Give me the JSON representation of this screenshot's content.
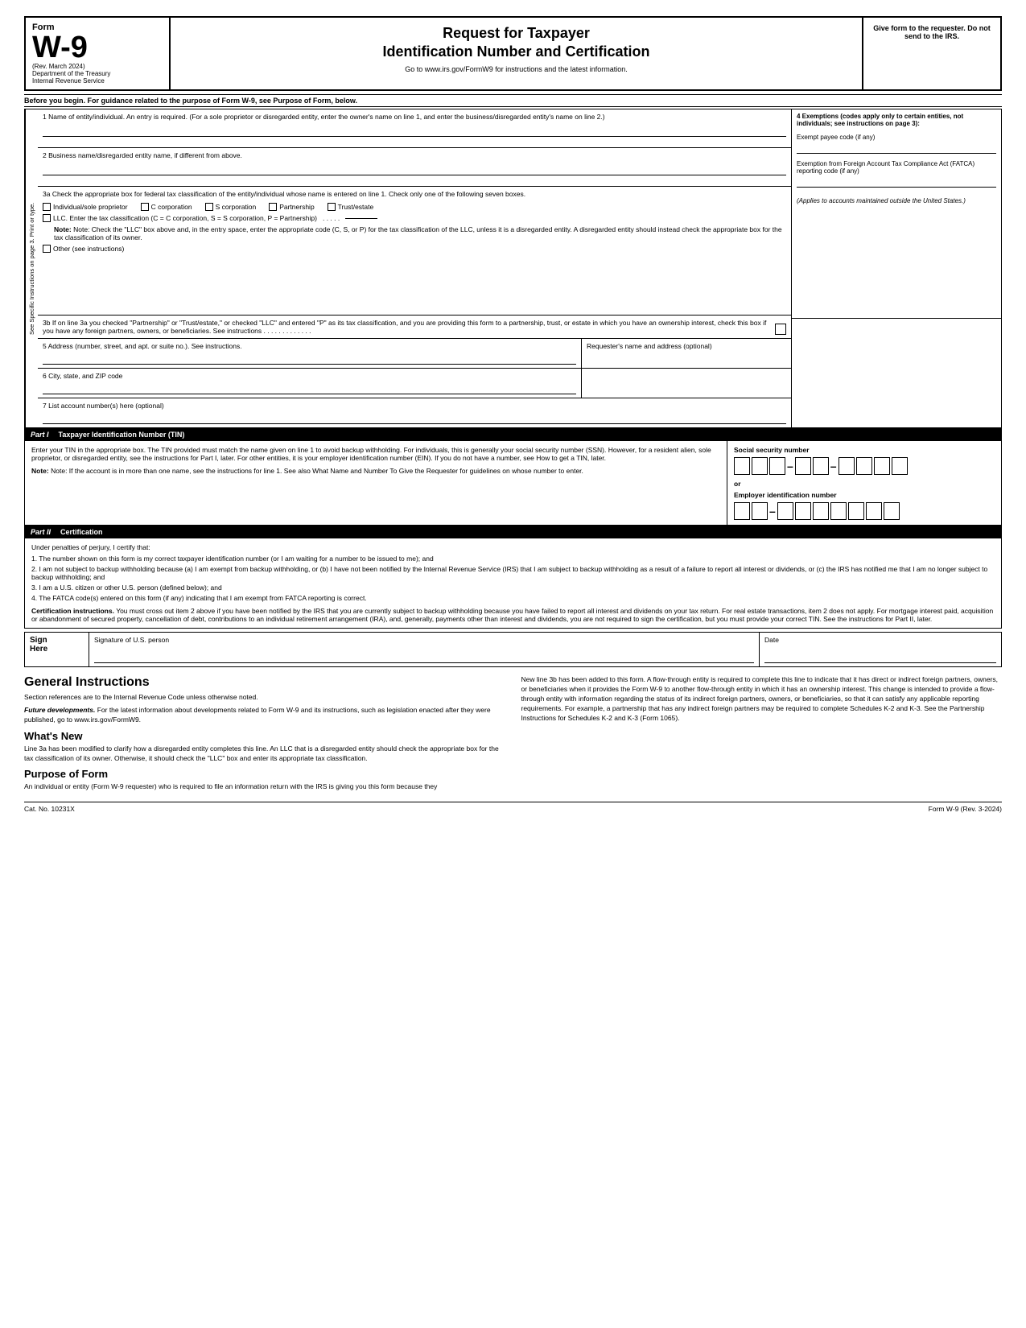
{
  "header": {
    "form_label": "Form",
    "form_number": "W-9",
    "rev_date": "(Rev. March 2024)",
    "dept": "Department of the Treasury",
    "irs": "Internal Revenue Service",
    "title_line1": "Request for Taxpayer",
    "title_line2": "Identification Number and Certification",
    "url_instruction": "Go to www.irs.gov/FormW9 for instructions and the latest information.",
    "give_form": "Give form to the requester. Do not send to the IRS."
  },
  "before_begin": {
    "text": "Before you begin. For guidance related to the purpose of Form W-9, see Purpose of Form, below."
  },
  "fields": {
    "field1_label": "1  Name of entity/individual. An entry is required. (For a sole proprietor or disregarded entity, enter the owner's name on line 1, and enter the business/disregarded entity's name on line 2.)",
    "field2_label": "2  Business name/disregarded entity name, if different from above.",
    "field3a_label": "3a Check the appropriate box for federal tax classification of the entity/individual whose name is entered on line 1. Check only one of the following seven boxes.",
    "checkbox_individual": "Individual/sole proprietor",
    "checkbox_c_corp": "C corporation",
    "checkbox_s_corp": "S corporation",
    "checkbox_partnership": "Partnership",
    "checkbox_trust": "Trust/estate",
    "checkbox_llc": "LLC. Enter the tax classification (C = C corporation, S = S corporation, P = Partnership)",
    "llc_dots": ". . . . .",
    "llc_note": "Note: Check the \"LLC\" box above and, in the entry space, enter the appropriate code (C, S, or P) for the tax classification of the LLC, unless it is a disregarded entity. A disregarded entity should instead check the appropriate box for the tax classification of its owner.",
    "checkbox_other": "Other (see instructions)",
    "field3b_text": "3b If on line 3a you checked \"Partnership\" or \"Trust/estate,\" or checked \"LLC\" and entered \"P\" as its tax classification, and you are providing this form to a partnership, trust, or estate in which you have an ownership interest, check this box if you have any foreign partners, owners, or beneficiaries. See instructions . . . . . . . . . . . . .",
    "field5_label": "5  Address (number, street, and apt. or suite no.). See instructions.",
    "field5_right": "Requester's name and address (optional)",
    "field6_label": "6  City, state, and ZIP code",
    "field7_label": "7  List account number(s) here (optional)"
  },
  "exemptions": {
    "title": "4 Exemptions (codes apply only to certain entities, not individuals; see instructions on page 3):",
    "exempt_payee": "Exempt payee code (if any)",
    "fatca_title": "Exemption from Foreign Account Tax Compliance Act (FATCA) reporting code (if any)",
    "applies_note": "(Applies to accounts maintained outside the United States.)"
  },
  "sidebar": {
    "text": "See Specific Instructions on page 3.   Print or type."
  },
  "part1": {
    "label": "Part I",
    "title": "Taxpayer Identification Number (TIN)",
    "instructions": "Enter your TIN in the appropriate box. The TIN provided must match the name given on line 1 to avoid backup withholding. For individuals, this is generally your social security number (SSN). However, for a resident alien, sole proprietor, or disregarded entity, see the instructions for Part I, later. For other entities, it is your employer identification number (EIN). If you do not have a number, see How to get a TIN, later.",
    "note": "Note: If the account is in more than one name, see the instructions for line 1. See also What Name and Number To Give the Requester for guidelines on whose number to enter.",
    "ssn_label": "Social security number",
    "ein_label": "Employer identification number",
    "or_text": "or"
  },
  "part2": {
    "label": "Part II",
    "title": "Certification",
    "intro": "Under penalties of perjury, I certify that:",
    "item1": "1. The number shown on this form is my correct taxpayer identification number (or I am waiting for a number to be issued to me); and",
    "item2": "2. I am not subject to backup withholding because (a) I am exempt from backup withholding, or (b) I have not been notified by the Internal Revenue Service (IRS) that I am subject to backup withholding as a result of a failure to report all interest or dividends, or (c) the IRS has notified me that I am no longer subject to backup withholding; and",
    "item3": "3. I am a U.S. citizen or other U.S. person (defined below); and",
    "item4": "4. The FATCA code(s) entered on this form (if any) indicating that I am exempt from FATCA reporting is correct.",
    "cert_instructions_label": "Certification instructions.",
    "cert_instructions": "You must cross out item 2 above if you have been notified by the IRS that you are currently subject to backup withholding because you have failed to report all interest and dividends on your tax return. For real estate transactions, item 2 does not apply. For mortgage interest paid, acquisition or abandonment of secured property, cancellation of debt, contributions to an individual retirement arrangement (IRA), and, generally, payments other than interest and dividends, you are not required to sign the certification, but you must provide your correct TIN. See the instructions for Part II, later."
  },
  "sign": {
    "sign_here": "Sign\nHere",
    "signature_label": "Signature of\nU.S. person",
    "date_label": "Date"
  },
  "general": {
    "title": "General Instructions",
    "section_refs": "Section references are to the Internal Revenue Code unless otherwise noted.",
    "future_dev_label": "Future developments.",
    "future_dev": "For the latest information about developments related to Form W-9 and its instructions, such as legislation enacted after they were published, go to www.irs.gov/FormW9.",
    "whats_new_title": "What's New",
    "whats_new": "Line 3a has been modified to clarify how a disregarded entity completes this line. An LLC that is a disregarded entity should check the appropriate box for the tax classification of its owner. Otherwise, it should check the \"LLC\" box and enter its appropriate tax classification.",
    "purpose_title": "Purpose of Form",
    "purpose_text": "An individual or entity (Form W-9 requester) who is required to file an information return with the IRS is giving you this form because they",
    "new_line_3b": "New line 3b has been added to this form. A flow-through entity is required to complete this line to indicate that it has direct or indirect foreign partners, owners, or beneficiaries when it provides the Form W-9 to another flow-through entity in which it has an ownership interest. This change is intended to provide a flow-through entity with information regarding the status of its indirect foreign partners, owners, or beneficiaries, so that it can satisfy any applicable reporting requirements. For example, a partnership that has any indirect foreign partners may be required to complete Schedules K-2 and K-3. See the Partnership Instructions for Schedules K-2 and K-3 (Form 1065)."
  },
  "footer": {
    "cat_no": "Cat. No. 10231X",
    "form_ref": "Form W-9 (Rev. 3-2024)"
  }
}
